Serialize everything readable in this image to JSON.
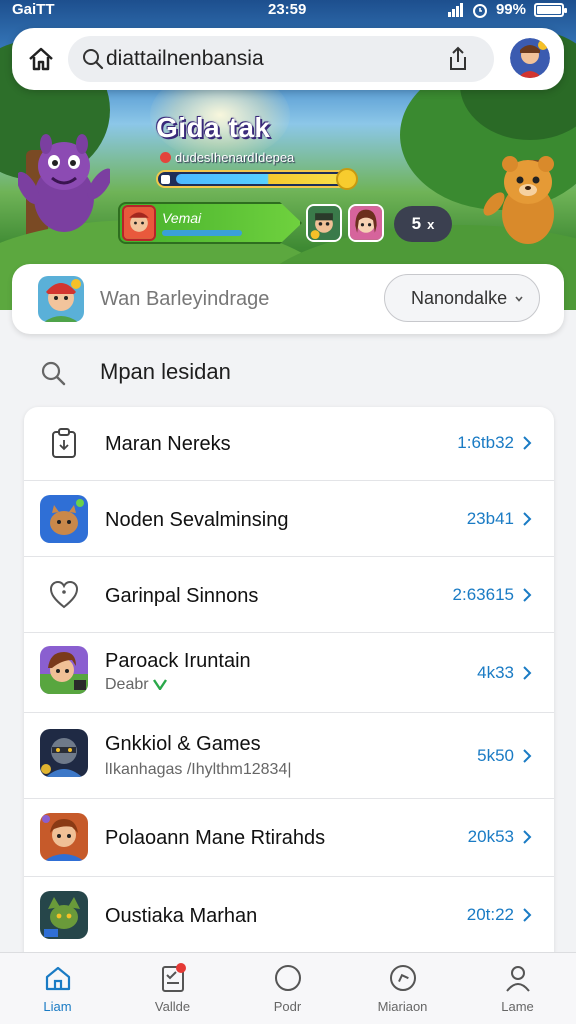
{
  "status_bar": {
    "carrier": "GaiTT",
    "time": "23:59",
    "battery": "99%",
    "battery_level": 0.99
  },
  "top_bar": {
    "search_text": "diattailnenbansia"
  },
  "hero": {
    "title": "Gida tak",
    "subtitle": "dudesIhenardIdepea",
    "xp_progress": 0.92,
    "player_name": "Vemai",
    "count": "5",
    "count_symbol": "x"
  },
  "profile": {
    "name": "Wan Barleyindrage",
    "dropdown_value": "Nanondalke"
  },
  "search_row": {
    "label": "Mpan lesidan"
  },
  "list": {
    "items": [
      {
        "title": "Maran Nereks",
        "value": "1:6tb32",
        "icon": "clipboard-icon"
      },
      {
        "title": "Noden Sevalminsing",
        "value": "23b41",
        "icon": "game-app-icon"
      },
      {
        "title": "Garinpal Sinnons",
        "value": "2:63615",
        "icon": "heart-icon"
      },
      {
        "title": "Paroack Iruntain",
        "subtitle": "Deabr",
        "value": "4k33",
        "icon": "game-app-icon"
      },
      {
        "title": "Gnkkiol & Games",
        "subtitle": "lIkanhagas /Ihylthm12834|",
        "value": "5k50",
        "icon": "game-app-icon"
      },
      {
        "title": "Polaoann Mane Rtirahds",
        "value": "20k53",
        "icon": "game-app-icon"
      },
      {
        "title": "Oustiaka Marhan",
        "value": "20t:22",
        "icon": "game-app-icon"
      }
    ]
  },
  "tabs": [
    {
      "label": "Liam",
      "icon": "home-icon",
      "active": true
    },
    {
      "label": "Vallde",
      "icon": "clipboard-icon",
      "active": false
    },
    {
      "label": "Podr",
      "icon": "circle-icon",
      "active": false
    },
    {
      "label": "Miariaon",
      "icon": "compass-icon",
      "active": false
    },
    {
      "label": "Lame",
      "icon": "person-icon",
      "active": false
    }
  ],
  "colors": {
    "accent": "#1a7bc4",
    "badge": "#e53935",
    "player_card": "#46b02c"
  }
}
